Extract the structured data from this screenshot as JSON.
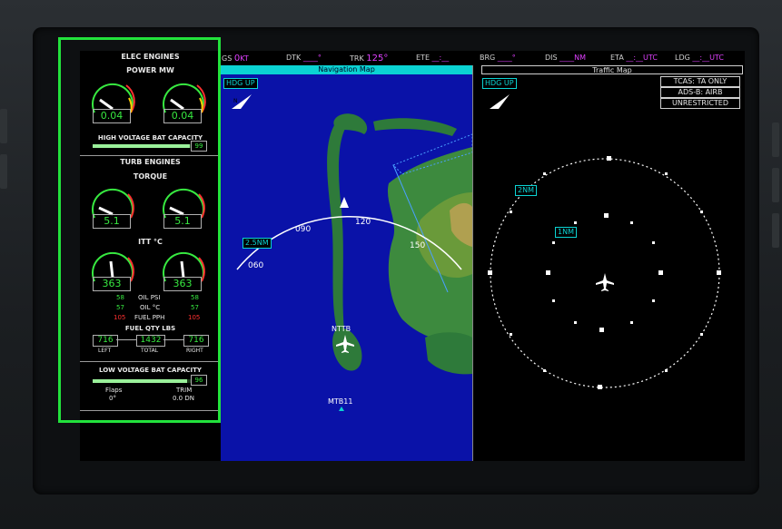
{
  "topbar": {
    "gs_label": "GS",
    "gs_value": "0",
    "gs_unit": "KT",
    "dtk_label": "DTK",
    "dtk_value": "____°",
    "trk_label": "TRK",
    "trk_value": "125°",
    "ete_label": "ETE",
    "ete_value": "__:__",
    "brg_label": "BRG",
    "brg_value": "____°",
    "dis_label": "DIS",
    "dis_value": "____",
    "dis_unit": "NM",
    "eta_label": "ETA",
    "eta_value": "__:__",
    "eta_unit": "UTC",
    "ldg_label": "LDG",
    "ldg_value": "__:__",
    "ldg_unit": "UTC"
  },
  "engines": {
    "title": "ELEC ENGINES",
    "power_label": "POWER MW",
    "power_left": "0.04",
    "power_right": "0.04",
    "power_left_level": 0.35,
    "power_right_level": 0.35,
    "hv_bat_label": "HIGH VOLTAGE BAT CAPACITY",
    "hv_bat_value": "99",
    "hv_bat_level": 0.99,
    "turb_title": "TURB ENGINES",
    "torque_label": "TORQUE",
    "torque_left": "5.1",
    "torque_right": "5.1",
    "torque_left_level": 0.3,
    "torque_right_level": 0.3,
    "itt_label": "ITT °C",
    "itt_left": "363",
    "itt_right": "363",
    "itt_left_level": 0.45,
    "itt_right_level": 0.45,
    "oil_psi_label": "OIL PSI",
    "oil_psi_left": "58",
    "oil_psi_right": "58",
    "oil_c_label": "OIL °C",
    "oil_c_left": "57",
    "oil_c_right": "57",
    "fuel_pph_label": "FUEL PPH",
    "fuel_pph_left": "105",
    "fuel_pph_right": "105",
    "fuel_qty_label": "FUEL QTY LBS",
    "fuel_left": "716",
    "fuel_total": "1432",
    "fuel_right": "716",
    "fuel_left_label": "LEFT",
    "fuel_total_label": "TOTAL",
    "fuel_right_label": "RIGHT",
    "lv_bat_label": "LOW VOLTAGE BAT CAPACITY",
    "lv_bat_value": "96",
    "lv_bat_level": 0.96,
    "flaps_label": "Flaps",
    "flaps_value": "0°",
    "trim_label": "TRIM",
    "trim_value": "0.0 DN"
  },
  "navmap": {
    "title": "Navigation Map",
    "orientation": "HDG UP",
    "range": "2.5NM",
    "hdg_060": "060",
    "hdg_090": "090",
    "hdg_120": "120",
    "hdg_150": "150",
    "north": "N",
    "airport": "NTTB",
    "waypoint": "MTB11"
  },
  "traffic": {
    "title": "Traffic Map",
    "orientation": "HDG UP",
    "north": "N",
    "tcas_mode": "TCAS: TA ONLY",
    "adsb_mode": "ADS-B: AIRB",
    "altitude_mode": "UNRESTRICTED",
    "ring_outer": "2NM",
    "ring_inner": "1NM"
  },
  "colors": {
    "accent_green": "#37e840",
    "magenta": "#e040ff",
    "cyan": "#0bd3d3",
    "highlight": "#22e23c"
  }
}
